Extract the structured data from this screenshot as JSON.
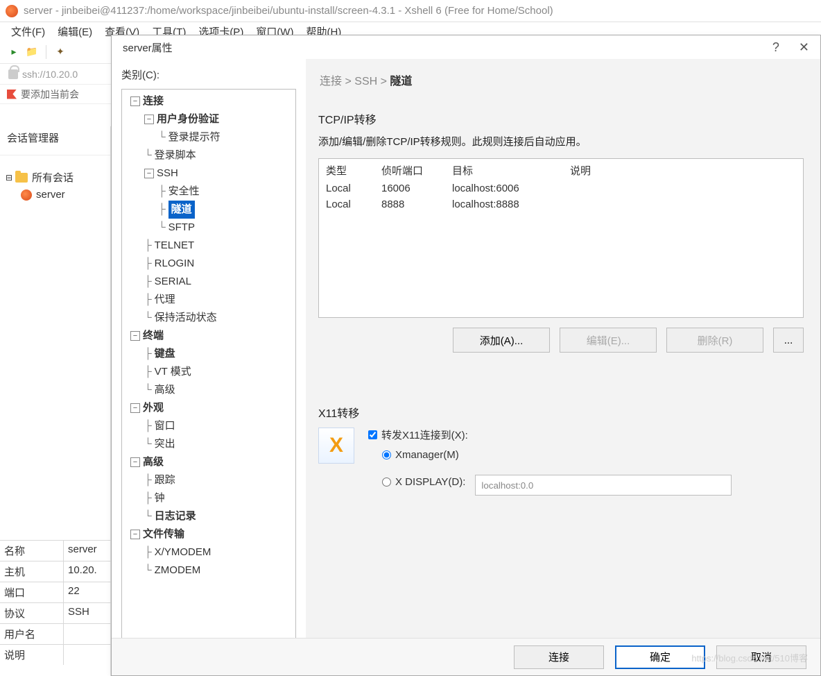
{
  "window": {
    "title": "server - jinbeibei@411237:/home/workspace/jinbeibei/ubuntu-install/screen-4.3.1 - Xshell 6 (Free for Home/School)"
  },
  "menu": {
    "file": "文件(F)",
    "edit": "编辑(E)",
    "view": "查看(V)",
    "tools": "工具(T)",
    "tabs": "选项卡(P)",
    "window": "窗口(W)",
    "help": "帮助(H)"
  },
  "address": {
    "url": "ssh://10.20.0"
  },
  "status_strip": {
    "text": "要添加当前会"
  },
  "session_mgr": {
    "title": "会话管理器",
    "root": "所有会话",
    "item": "server"
  },
  "props": {
    "name_k": "名称",
    "name_v": "server",
    "host_k": "主机",
    "host_v": "10.20.",
    "port_k": "端口",
    "port_v": "22",
    "proto_k": "协议",
    "proto_v": "SSH",
    "user_k": "用户名",
    "user_v": "",
    "desc_k": "说明",
    "desc_v": ""
  },
  "dialog": {
    "title": "server属性",
    "help": "?",
    "close": "✕",
    "category_label": "类别(C):",
    "tree": {
      "conn": "连接",
      "auth": "用户身份验证",
      "loginprompt": "登录提示符",
      "loginscript": "登录脚本",
      "ssh": "SSH",
      "security": "安全性",
      "tunnel": "隧道",
      "sftp": "SFTP",
      "telnet": "TELNET",
      "rlogin": "RLOGIN",
      "serial": "SERIAL",
      "proxy": "代理",
      "keepalive": "保持活动状态",
      "terminal": "终端",
      "keyboard": "键盘",
      "vt": "VT 模式",
      "advanced_t": "高级",
      "appearance": "外观",
      "window": "窗口",
      "highlight": "突出",
      "advanced": "高级",
      "trace": "跟踪",
      "bell": "钟",
      "logging": "日志记录",
      "filetrans": "文件传输",
      "xymodem": "X/YMODEM",
      "zmodem": "ZMODEM"
    },
    "breadcrumb": {
      "conn": "连接",
      "ssh": "SSH",
      "tunnel": "隧道",
      "sep": ">"
    },
    "tcp": {
      "title": "TCP/IP转移",
      "desc": "添加/编辑/删除TCP/IP转移规则。此规则连接后自动应用。",
      "cols": {
        "type": "类型",
        "port": "侦听端口",
        "target": "目标",
        "desc": "说明"
      },
      "rows": [
        {
          "type": "Local",
          "port": "16006",
          "target": "localhost:6006",
          "desc": ""
        },
        {
          "type": "Local",
          "port": "8888",
          "target": "localhost:8888",
          "desc": ""
        }
      ],
      "add": "添加(A)...",
      "edit": "编辑(E)...",
      "del": "删除(R)",
      "more": "..."
    },
    "x11": {
      "title": "X11转移",
      "forward": "转发X11连接到(X):",
      "xmanager": "Xmanager(M)",
      "xdisplay": "X DISPLAY(D):",
      "display_value": "localhost:0.0"
    },
    "footer": {
      "connect": "连接",
      "ok": "确定",
      "cancel": "取消"
    }
  },
  "watermark": "https://blog.csdn.net/510博客"
}
